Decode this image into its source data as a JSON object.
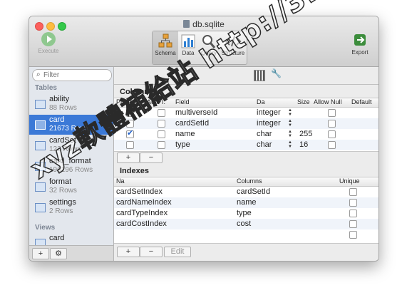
{
  "window": {
    "title": "db.sqlite"
  },
  "toolbar": {
    "execute": "Execute",
    "schema": "Schema",
    "data": "Data",
    "query": "Query",
    "structure": "Structure",
    "export": "Export"
  },
  "sidebar": {
    "filter_placeholder": "Filter",
    "tables_header": "Tables",
    "views_header": "Views",
    "tables": [
      {
        "name": "ability",
        "rows": "88 Rows"
      },
      {
        "name": "card",
        "rows": "21673 Rows",
        "selected": true
      },
      {
        "name": "cardSet",
        "rows": "122 Rows"
      },
      {
        "name": "card_format",
        "rows": "196196 Rows"
      },
      {
        "name": "format",
        "rows": "32 Rows"
      },
      {
        "name": "settings",
        "rows": "2 Rows"
      }
    ],
    "views": [
      {
        "name": "card"
      }
    ],
    "add_label": "+",
    "gear_icon": "gear-icon"
  },
  "columns_panel": {
    "title": "Columns",
    "headers": {
      "primary": "Primary",
      "auto": "Auto I.",
      "field": "Field",
      "type": "Da",
      "size": "Size",
      "allow_null": "Allow Null",
      "default": "Default"
    },
    "rows": [
      {
        "primary": true,
        "auto": false,
        "field": "multiverseId",
        "type": "integer",
        "size": "",
        "allow_null": false
      },
      {
        "primary": false,
        "auto": false,
        "field": "cardSetId",
        "type": "integer",
        "size": "",
        "allow_null": false
      },
      {
        "primary": true,
        "auto": false,
        "field": "name",
        "type": "char",
        "size": "255",
        "allow_null": false
      },
      {
        "primary": false,
        "auto": false,
        "field": "type",
        "type": "char",
        "size": "16",
        "allow_null": false
      }
    ],
    "add": "+",
    "remove": "−"
  },
  "indexes_panel": {
    "title": "Indexes",
    "headers": {
      "name": "Na",
      "columns": "Columns",
      "unique": "Unique"
    },
    "rows": [
      {
        "name": "cardSetIndex",
        "columns": "cardSetId"
      },
      {
        "name": "cardNameIndex",
        "columns": "name"
      },
      {
        "name": "cardTypeIndex",
        "columns": "type"
      },
      {
        "name": "cardCostIndex",
        "columns": "cost"
      },
      {
        "name": "",
        "columns": ""
      }
    ],
    "add": "+",
    "remove": "−",
    "edit": "Edit"
  },
  "watermark": "xyz軟體補給站 http://31.to",
  "colors": {
    "selection": "#3b79d7",
    "checkbox": "#1e5fc9"
  }
}
